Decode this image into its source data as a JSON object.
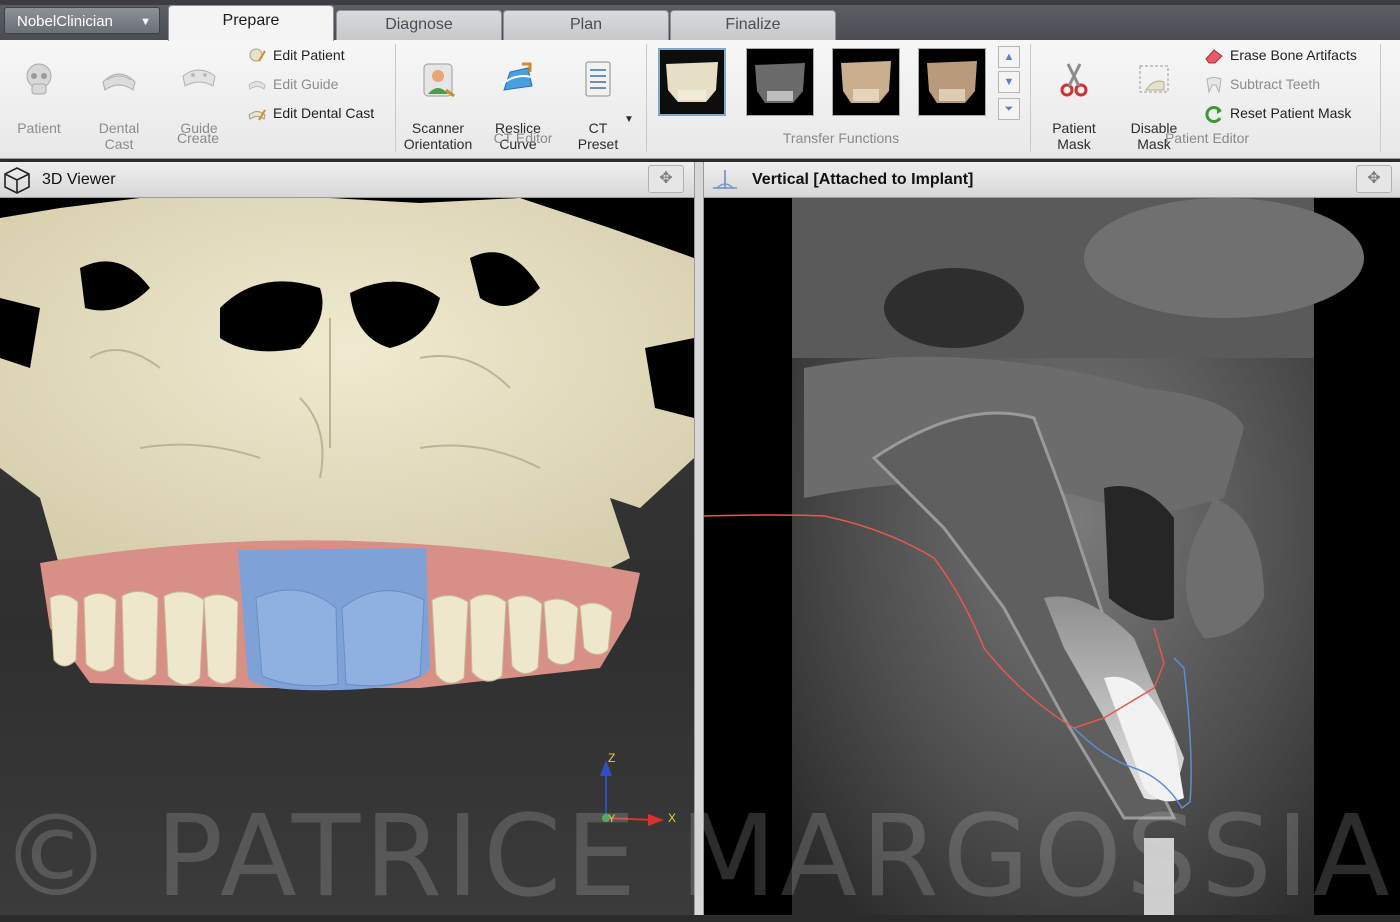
{
  "app_menu": {
    "label": "NobelClinician"
  },
  "tabs": [
    {
      "label": "Prepare",
      "active": true
    },
    {
      "label": "Diagnose",
      "active": false
    },
    {
      "label": "Plan",
      "active": false
    },
    {
      "label": "Finalize",
      "active": false
    }
  ],
  "ribbon": {
    "create": {
      "group_label": "Create",
      "patient": "Patient",
      "dental_cast": "Dental\nCast",
      "guide": "Guide",
      "edit_patient": "Edit Patient",
      "edit_guide": "Edit Guide",
      "edit_dental_cast": "Edit Dental Cast"
    },
    "ct_editor": {
      "group_label": "CT Editor",
      "scanner_orientation": "Scanner\nOrientation",
      "reslice_curve": "Reslice\nCurve",
      "ct_preset": "CT\nPreset"
    },
    "transfer_functions": {
      "group_label": "Transfer Functions",
      "selected_index": 0
    },
    "patient_editor": {
      "group_label": "Patient Editor",
      "patient_mask": "Patient\nMask",
      "disable_mask": "Disable\nMask",
      "erase_bone_artifacts": "Erase Bone Artifacts",
      "subtract_teeth": "Subtract Teeth",
      "reset_patient_mask": "Reset Patient Mask"
    }
  },
  "viewer3d": {
    "title": "3D Viewer",
    "axes": {
      "z": "Z",
      "y": "Y",
      "x": "X"
    }
  },
  "ctview": {
    "title": "Vertical [Attached to Implant]"
  },
  "watermark": {
    "text": "© PATRICE MARGOSSIAN"
  },
  "colors": {
    "bone": "#e8e2c4",
    "gingiva": "#d88f86",
    "guide_blue": "#7ea2d8",
    "trace_red": "#e5584c",
    "trace_blue": "#5a8fd6",
    "axis_z": "#2f4fc7",
    "axis_x": "#d8322b"
  }
}
